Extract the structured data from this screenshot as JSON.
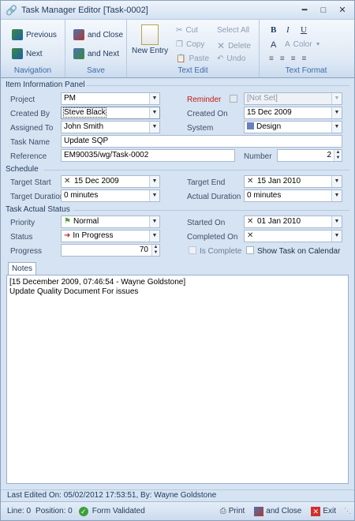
{
  "window": {
    "title": "Task Manager Editor [Task-0002]"
  },
  "ribbon": {
    "navigation": {
      "label": "Navigation",
      "previous": "Previous",
      "next": "Next"
    },
    "save": {
      "label": "Save",
      "and_close": "and Close",
      "and_next": "and Next"
    },
    "text_edit": {
      "label": "Text Edit",
      "new_entry": "New Entry",
      "cut": "Cut",
      "copy": "Copy",
      "paste": "Paste",
      "select_all": "Select All",
      "delete": "Delete",
      "undo": "Undo"
    },
    "text_format": {
      "label": "Text Format",
      "bold": "B",
      "italic": "I",
      "underline": "U",
      "font": "A",
      "color": "Color"
    }
  },
  "item_info": {
    "title": "Item Information Panel",
    "project_label": "Project",
    "project": "PM",
    "reminder_label": "Reminder",
    "reminder": "[Not Set]",
    "created_by_label": "Created By",
    "created_by": "Steve Black",
    "created_on_label": "Created On",
    "created_on": "15 Dec 2009",
    "assigned_to_label": "Assigned To",
    "assigned_to": "John Smith",
    "system_label": "System",
    "system": "Design",
    "task_name_label": "Task Name",
    "task_name": "Update SQP",
    "reference_label": "Reference",
    "reference": "EM90035/wg/Task-0002",
    "number_label": "Number",
    "number": "2"
  },
  "schedule": {
    "title": "Schedule",
    "target_start_label": "Target Start",
    "target_start": "15 Dec 2009",
    "target_end_label": "Target End",
    "target_end": "15 Jan 2010",
    "target_duration_label": "Target Duration",
    "target_duration": "0 minutes",
    "actual_duration_label": "Actual Duration",
    "actual_duration": "0 minutes"
  },
  "actual_status": {
    "title": "Task Actual Status",
    "priority_label": "Priority",
    "priority": "Normal",
    "started_on_label": "Started On",
    "started_on": "01 Jan 2010",
    "status_label": "Status",
    "status": "In Progress",
    "completed_on_label": "Completed On",
    "completed_on": "",
    "progress_label": "Progress",
    "progress": "70",
    "is_complete_label": "Is Complete",
    "show_on_calendar_label": "Show Task on Calendar"
  },
  "notes": {
    "tab_label": "Notes",
    "line1": "[15 December 2009, 07:46:54 - Wayne Goldstone]",
    "line2": "Update Quality Document For issues"
  },
  "footer": {
    "last_edited": "Last Edited On: 05/02/2012 17:53:51, By: Wayne Goldstone",
    "line": "Line: 0",
    "position": "Position: 0",
    "validated": "Form Validated",
    "print": "Print",
    "and_close": "and Close",
    "exit": "Exit"
  }
}
